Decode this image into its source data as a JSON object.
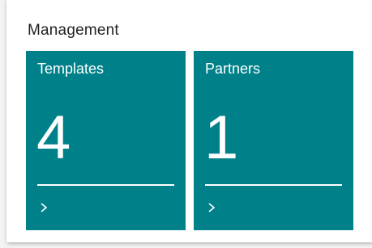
{
  "section": {
    "title": "Management"
  },
  "tiles": [
    {
      "label": "Templates",
      "count": "4",
      "icon": "chevron-right-icon"
    },
    {
      "label": "Partners",
      "count": "1",
      "icon": "chevron-right-icon"
    }
  ],
  "colors": {
    "tile_background": "#00818a",
    "tile_text": "#ffffff",
    "title_text": "#222222"
  }
}
